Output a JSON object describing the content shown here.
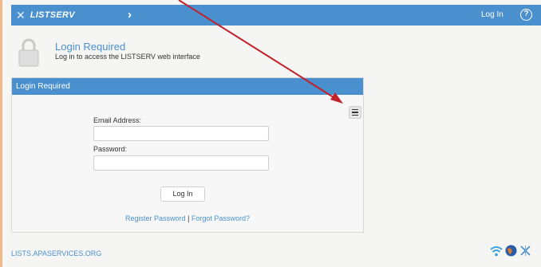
{
  "topbar": {
    "logo_text": "LISTSERV",
    "logo_icon": "listserv-logo-icon",
    "chevron": "›",
    "login_label": "Log In",
    "help_icon": "help-circle-icon",
    "help_glyph": "?"
  },
  "header": {
    "title": "Login Required",
    "subtitle": "Log in to access the LISTSERV web interface",
    "icon": "lock-icon"
  },
  "panel": {
    "title": "Login Required",
    "menu_icon": "hamburger-menu-icon",
    "email_label": "Email Address:",
    "email_value": "",
    "password_label": "Password:",
    "password_value": "",
    "login_button": "Log In",
    "register_link": "Register Password",
    "separator": "|",
    "forgot_link": "Forgot Password?"
  },
  "footer": {
    "host": "LISTS.APASERVICES.ORG",
    "icons": [
      "wifi-icon",
      "globe-icon",
      "listserv-logo-icon"
    ]
  },
  "colors": {
    "accent": "#4a90cf",
    "annotation_arrow": "#c0212b"
  }
}
